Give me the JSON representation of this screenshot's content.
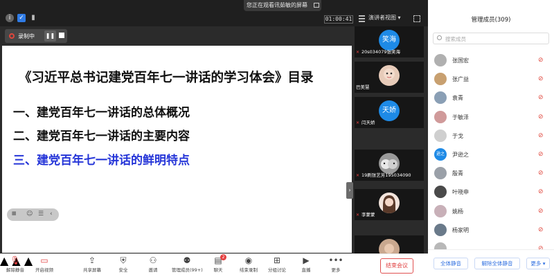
{
  "topbar": {
    "share_banner": "您正在观看讯茹敏的屏幕",
    "timer": "01:00:41",
    "view_label": "演讲者视图 ▾"
  },
  "recording": {
    "label": "录制中"
  },
  "slide": {
    "title": "《习近平总书记建党百年七一讲话的学习体会》目录",
    "toc": [
      "一、建党百年七一讲话的总体概况",
      "二、建党百年七一讲话的主要内容",
      "三、建党百年七一讲话的鲜明特点"
    ],
    "toc_highlight_color": "#2535d8"
  },
  "video_tiles": [
    {
      "name": "20s034079张笑海",
      "avatar_text": "笑海",
      "avatar_color": "#1e8ae6"
    },
    {
      "name": "巴美慧",
      "avatar_text": "",
      "avatar_color": "#d9b8a6"
    },
    {
      "name": "闫天娇",
      "avatar_text": "天娇",
      "avatar_color": "#1e8ae6"
    },
    {
      "name": "19刷张艺芳195034090",
      "avatar_text": "",
      "avatar_color": "#8c8c8c"
    },
    {
      "name": "李蒙蒙",
      "avatar_text": "",
      "avatar_color": "#e8d3c8"
    },
    {
      "name": "",
      "avatar_text": "",
      "avatar_color": "#c9a88f"
    }
  ],
  "panel": {
    "title": "管理成员(309)",
    "search_placeholder": "搜索成员",
    "members": [
      {
        "name": "张国宏",
        "avatar_text": "",
        "avatar_color": "#b0b0b0"
      },
      {
        "name": "张广益",
        "avatar_text": "",
        "avatar_color": "#c8a070"
      },
      {
        "name": "袁青",
        "avatar_text": "",
        "avatar_color": "#8a9fb5"
      },
      {
        "name": "于敏泽",
        "avatar_text": "",
        "avatar_color": "#d09a9a"
      },
      {
        "name": "于戈",
        "avatar_text": "",
        "avatar_color": "#cfcfcf"
      },
      {
        "name": "尹逊之",
        "avatar_text": "逊之",
        "avatar_color": "#1e8ae6"
      },
      {
        "name": "殷青",
        "avatar_text": "",
        "avatar_color": "#9aa0a8"
      },
      {
        "name": "叶晓申",
        "avatar_text": "",
        "avatar_color": "#4a4a4a"
      },
      {
        "name": "姚杨",
        "avatar_text": "",
        "avatar_color": "#c8b0b8"
      },
      {
        "name": "杨家明",
        "avatar_text": "",
        "avatar_color": "#6a7a8a"
      },
      {
        "name": "...",
        "avatar_text": "",
        "avatar_color": "#b8b8b8"
      }
    ],
    "mute_all": "全体静音",
    "unmute_all": "解除全体静音",
    "more": "更多 ▾"
  },
  "toolbar": {
    "mute": "解除静音",
    "video": "开启视频",
    "share": "共享屏幕",
    "security": "安全",
    "invite": "邀请",
    "members": "管理成员(99+)",
    "chat": "聊天",
    "chat_badge": "2",
    "end_record": "结束录制",
    "breakout": "分组讨论",
    "live": "直播",
    "more": "更多",
    "end_meeting": "结束会议"
  }
}
